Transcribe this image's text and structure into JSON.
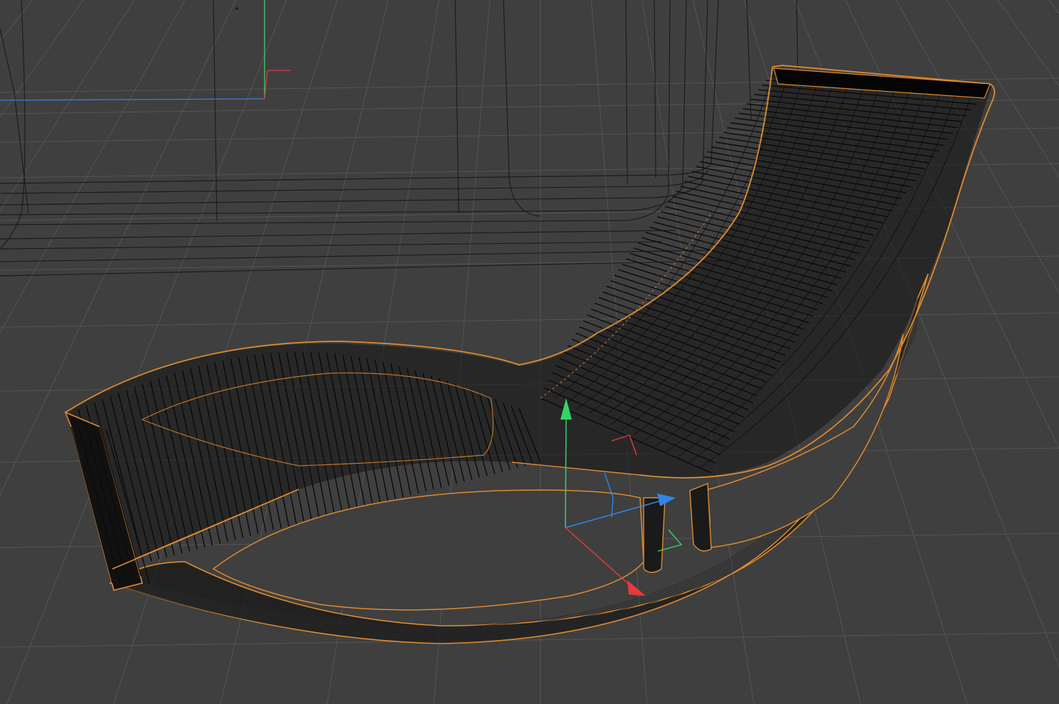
{
  "viewport": {
    "background": "#3f3f3f",
    "grid_color": "#555555",
    "wire_color": "#0a0a0a",
    "selection_outline_color": "#e08a2e"
  },
  "world_axis": {
    "x_color": "#e03a3a",
    "y_color": "#3ad26a",
    "z_color": "#3a7ae0"
  },
  "gizmo": {
    "x_color": "#e8393c",
    "y_color": "#35d467",
    "z_color": "#2f86ea",
    "icons": [
      "move-x-arrow-icon",
      "move-y-arrow-icon",
      "move-z-arrow-icon"
    ]
  },
  "object": {
    "selected": true
  }
}
